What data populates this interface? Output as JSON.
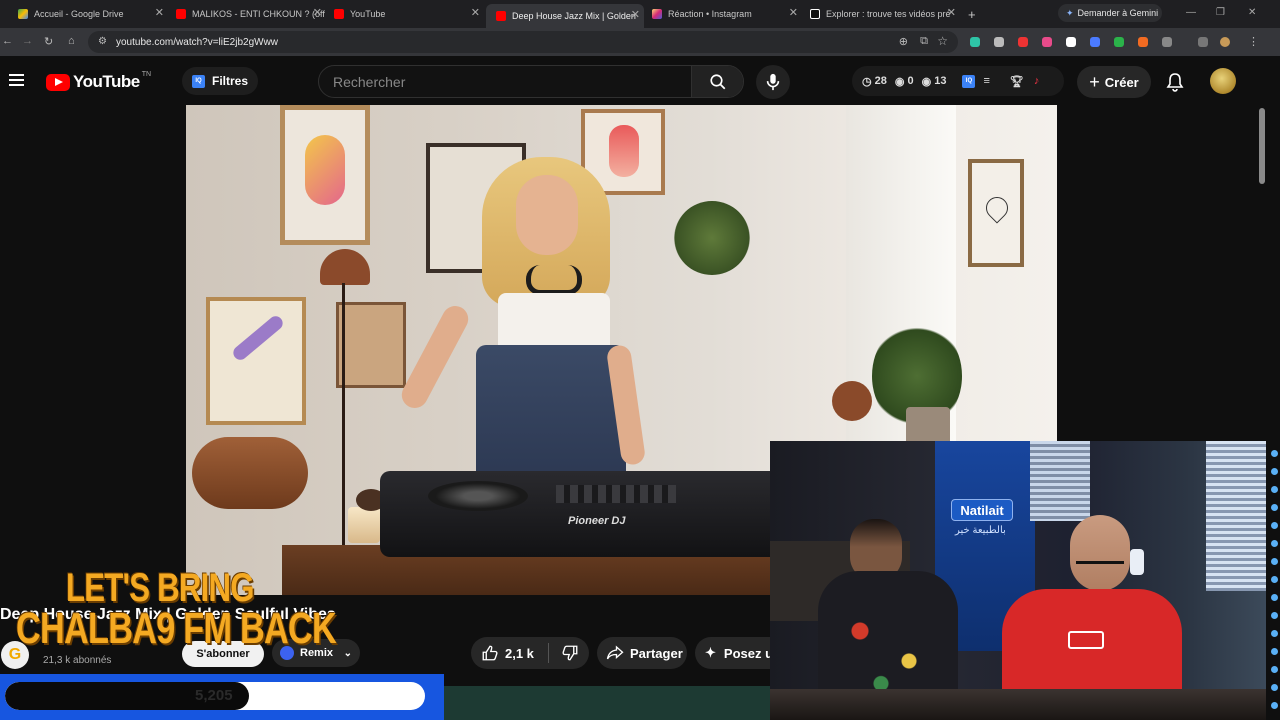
{
  "browser": {
    "tabs": [
      {
        "title": "Accueil - Google Drive",
        "favicon_color": "#34a853",
        "icon": "google-drive-icon"
      },
      {
        "title": "MALIKOS - ENTI CHKOUN ? (off",
        "favicon_color": "#ff0000",
        "icon": "youtube-icon"
      },
      {
        "title": "YouTube",
        "favicon_color": "#ff0000",
        "icon": "youtube-icon"
      },
      {
        "title": "Deep House Jazz Mix | Golden",
        "favicon_color": "#ff0000",
        "icon": "youtube-icon",
        "active": true
      },
      {
        "title": "Réaction • Instagram",
        "favicon_color": "#e1306c",
        "icon": "instagram-icon"
      },
      {
        "title": "Explorer : trouve tes vidéos pré",
        "favicon_color": "#ffffff",
        "icon": "tiktok-icon"
      }
    ],
    "new_tab": "+",
    "gemini_label": "Demander à Gemini",
    "url": "youtube.com/watch?v=liE2jb2gWww"
  },
  "header": {
    "logo_text": "YouTube",
    "logo_country": "TN",
    "filters_label": "Filtres",
    "iq_badge": "IQ",
    "search_placeholder": "Rechercher",
    "stats": {
      "watch_later": "28",
      "views_a": "0",
      "views_b": "13"
    },
    "create_label": "Créer"
  },
  "video": {
    "title": "Deep House Jazz Mix | Golden Soulful Vibes",
    "channel_initial": "G",
    "subscribers": "21,3 k abonnés",
    "subscribe_label": "S'abonner",
    "remix_label": "Remix",
    "likes": "2,1 k",
    "share_label": "Partager",
    "ask_label": "Posez une question",
    "controller_brand": "Pioneer DJ"
  },
  "overlay": {
    "line1": "LET'S BRING",
    "line2": "CHALBA9 FM BACK",
    "progress_text": "5,205",
    "progress_fraction": 0.58,
    "panel_color": "#1756e0",
    "text_color": "#f4a922"
  },
  "webcam": {
    "sign_text": "Natilait",
    "sign_subtext": "بالطبيعة خير"
  }
}
